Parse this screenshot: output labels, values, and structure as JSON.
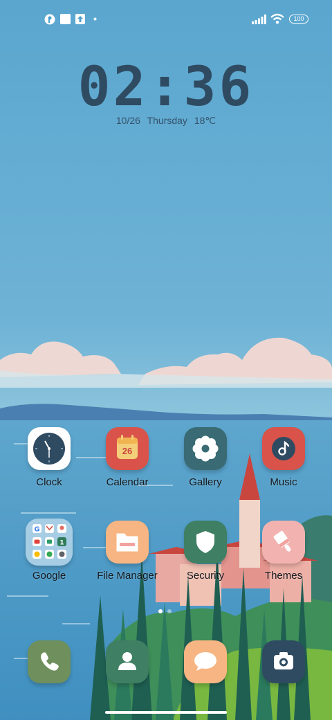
{
  "status_bar": {
    "battery_level": "100",
    "left_icons": [
      "app-notification-icon",
      "square-notification-icon",
      "upload-icon",
      "more-dot-icon"
    ],
    "right_icons": [
      "signal-icon",
      "wifi-icon",
      "battery-icon"
    ]
  },
  "clock": {
    "time": "02:36",
    "date": "10/26",
    "weekday": "Thursday",
    "temperature": "18℃"
  },
  "apps_row1": [
    {
      "label": "Clock",
      "icon": "clock-icon",
      "color": "#ffffff"
    },
    {
      "label": "Calendar",
      "icon": "calendar-icon",
      "color": "#d9534a",
      "day": "26"
    },
    {
      "label": "Gallery",
      "icon": "flower-gear-icon",
      "color": "#3a6b74"
    },
    {
      "label": "Music",
      "icon": "music-icon",
      "color": "#d9534a"
    }
  ],
  "apps_row2": [
    {
      "label": "Google",
      "icon": "google-folder-icon",
      "color": "#b9d6e6"
    },
    {
      "label": "File Manager",
      "icon": "folder-icon",
      "color": "#f6b582"
    },
    {
      "label": "Security",
      "icon": "shield-icon",
      "color": "#3f7f63"
    },
    {
      "label": "Themes",
      "icon": "brush-icon",
      "color": "#f2b3b0"
    }
  ],
  "dock": [
    {
      "name": "phone",
      "icon": "phone-icon",
      "color": "#6f8f5c"
    },
    {
      "name": "contacts",
      "icon": "contacts-icon",
      "color": "#3f7f63"
    },
    {
      "name": "messages",
      "icon": "message-icon",
      "color": "#f6b582"
    },
    {
      "name": "camera",
      "icon": "camera-icon",
      "color": "#2f4b62"
    }
  ],
  "page_indicator": {
    "pages": 2,
    "current": 1
  },
  "colors": {
    "sky": "#5fa8cf",
    "sea": "#4d9bc7",
    "accent": "#d9534a"
  }
}
